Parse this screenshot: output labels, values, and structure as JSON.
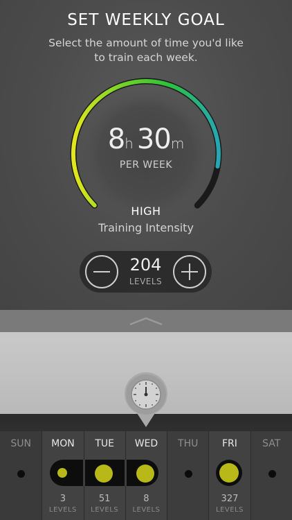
{
  "header": {
    "title": "SET WEEKLY GOAL",
    "subtitle_line1": "Select the amount of time you'd like",
    "subtitle_line2": "to train each week."
  },
  "gauge": {
    "hours": "8",
    "hours_unit": "h",
    "minutes": "30",
    "minutes_unit": "m",
    "period": "PER WEEK",
    "intensity": "HIGH",
    "intensity_label": "Training Intensity",
    "fill_fraction": 0.87
  },
  "stepper": {
    "value": "204",
    "unit": "LEVELS"
  },
  "days": [
    {
      "name": "SUN",
      "active": false,
      "count": "",
      "unit": ""
    },
    {
      "name": "MON",
      "active": true,
      "count": "3",
      "unit": "LEVELS"
    },
    {
      "name": "TUE",
      "active": true,
      "count": "51",
      "unit": "LEVELS"
    },
    {
      "name": "WED",
      "active": true,
      "count": "8",
      "unit": "LEVELS"
    },
    {
      "name": "THU",
      "active": false,
      "count": "",
      "unit": ""
    },
    {
      "name": "FRI",
      "active": true,
      "count": "327",
      "unit": "LEVELS"
    },
    {
      "name": "SAT",
      "active": false,
      "count": "",
      "unit": ""
    }
  ],
  "colors": {
    "accent_yellow": "#b8b819",
    "gauge_yellow": "#e4e61e",
    "gauge_green": "#2ec13a",
    "gauge_teal": "#25a7b4"
  },
  "icons": {
    "pull_handle": "chevron-up-icon",
    "timer": "clock-icon",
    "minus": "minus-icon",
    "plus": "plus-icon"
  }
}
